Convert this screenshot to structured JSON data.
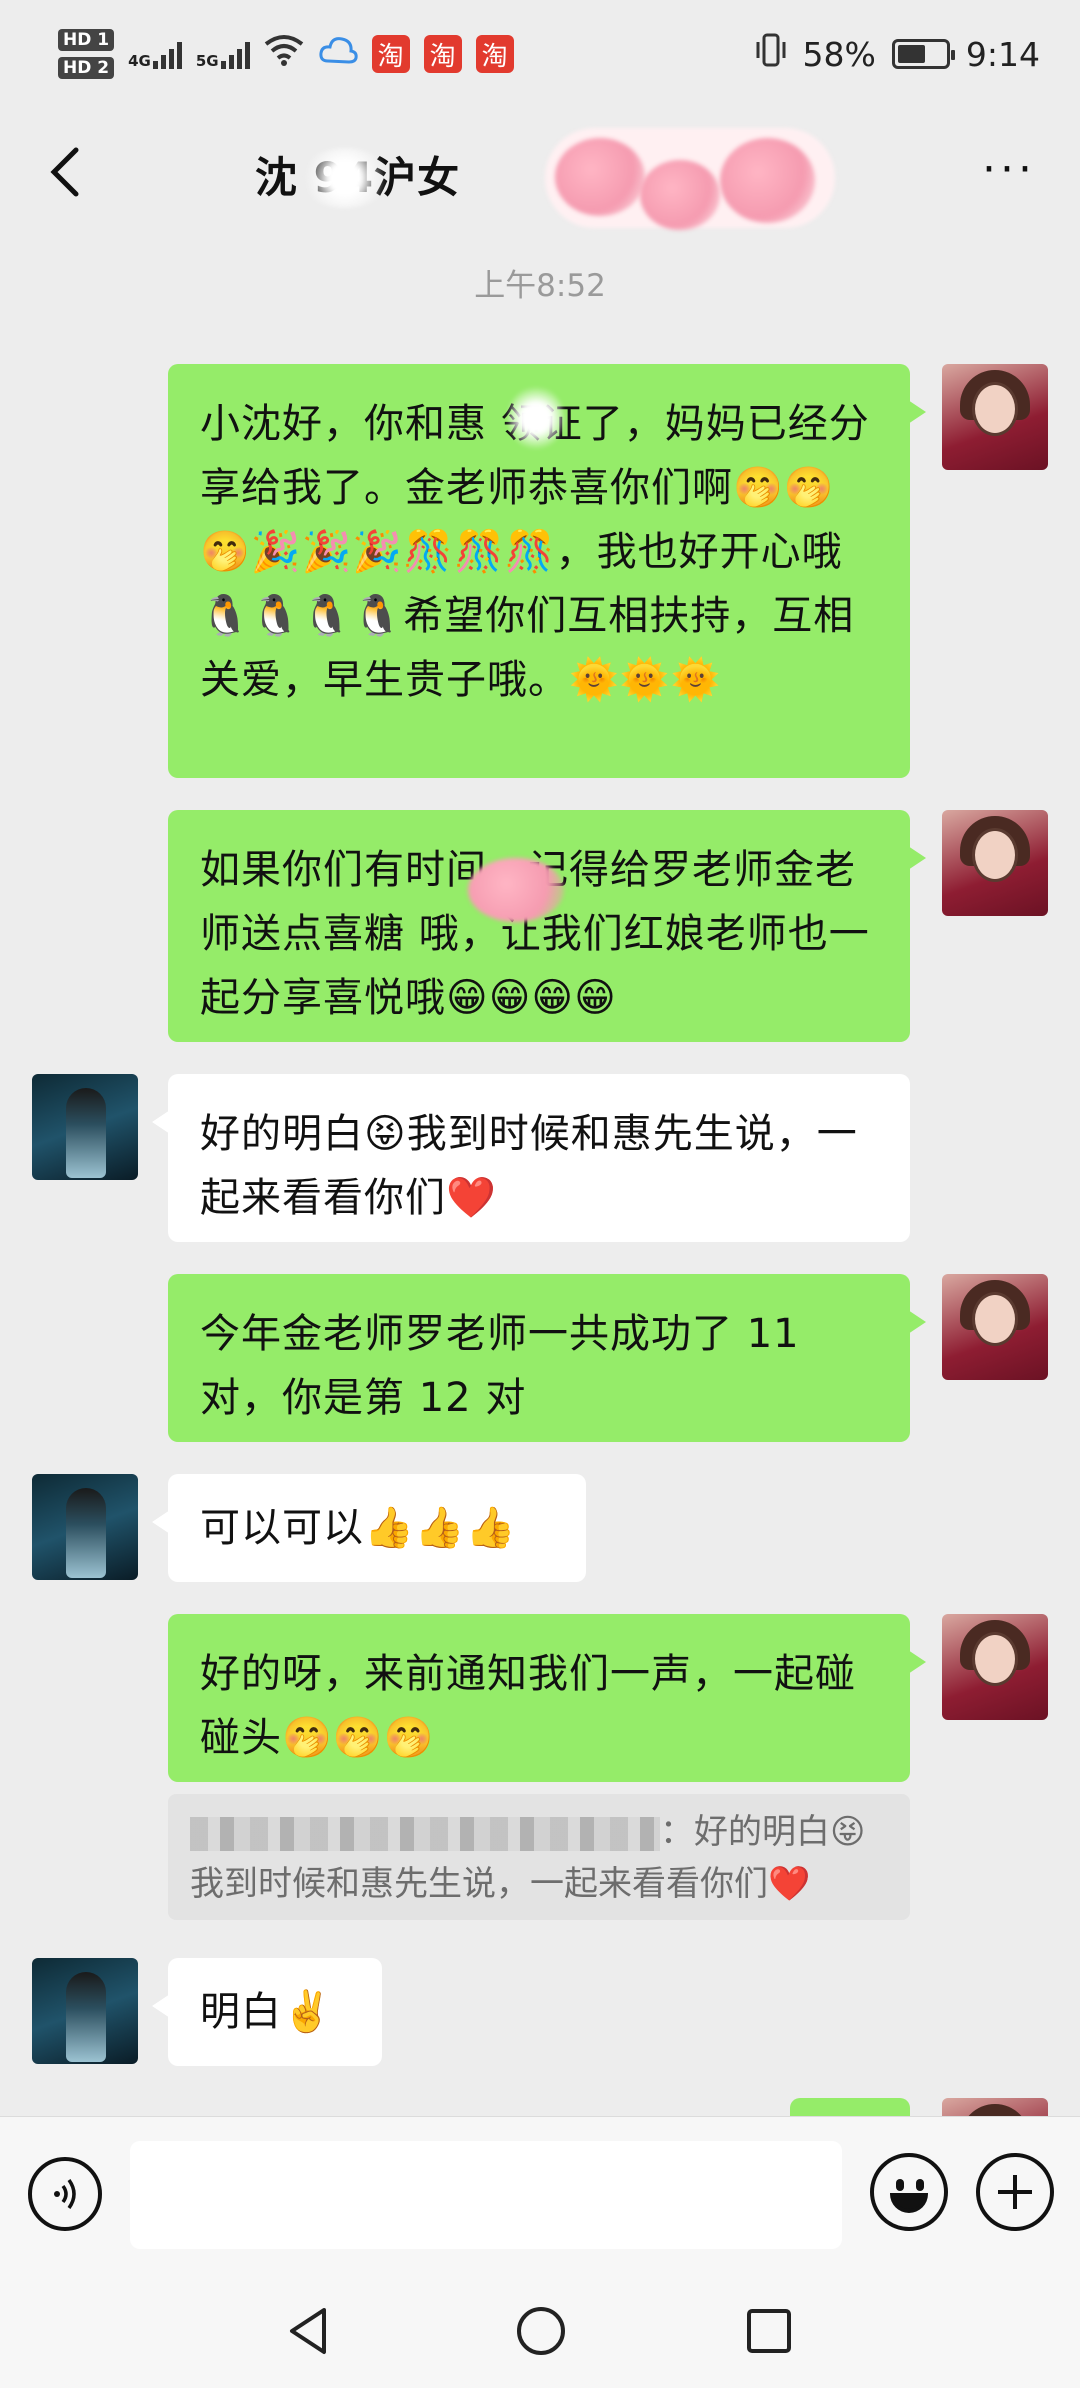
{
  "status_bar": {
    "hd1": "HD 1",
    "hd2": "HD 2",
    "net1": "4G",
    "net2": "5G",
    "taobao_icons": [
      "淘",
      "淘",
      "淘"
    ],
    "battery_percent": "58%",
    "battery_level": 0.58,
    "time": "9:14"
  },
  "header": {
    "title": "沈 94沪女",
    "more_label": "···"
  },
  "chat": {
    "timestamp": "上午8:52",
    "messages": [
      {
        "side": "me",
        "text": "小沈好，你和惠 领证了，妈妈已经分享给我了。金老师恭喜你们啊🤭🤭🤭🎉🎉🎉🎊🎊🎊，我也好开心哦🐧🐧🐧🐧希望你们互相扶持，互相关爱，早生贵子哦。🌞🌞🌞"
      },
      {
        "side": "me",
        "text": "如果你们有时间，记得给罗老师金老师送点喜糖 哦，让我们红娘老师也一起分享喜悦哦😁😁😁😁"
      },
      {
        "side": "other",
        "text": "好的明白😝我到时候和惠先生说，一起来看看你们❤️"
      },
      {
        "side": "me",
        "text": "今年金老师罗老师一共成功了 11 对，你是第 12 对"
      },
      {
        "side": "other",
        "text": "可以可以👍👍👍"
      },
      {
        "side": "me",
        "text": "好的呀，来前通知我们一声，一起碰碰头🤭🤭🤭"
      },
      {
        "side": "other",
        "text": "明白✌️"
      }
    ],
    "quote": {
      "text_line1": "：好的明白😝",
      "text_line2": "我到时候和惠先生说，一起来看看你们❤️"
    }
  },
  "input_bar": {
    "placeholder": ""
  },
  "colors": {
    "background": "#ededed",
    "my_bubble": "#95ec69",
    "other_bubble": "#ffffff"
  }
}
